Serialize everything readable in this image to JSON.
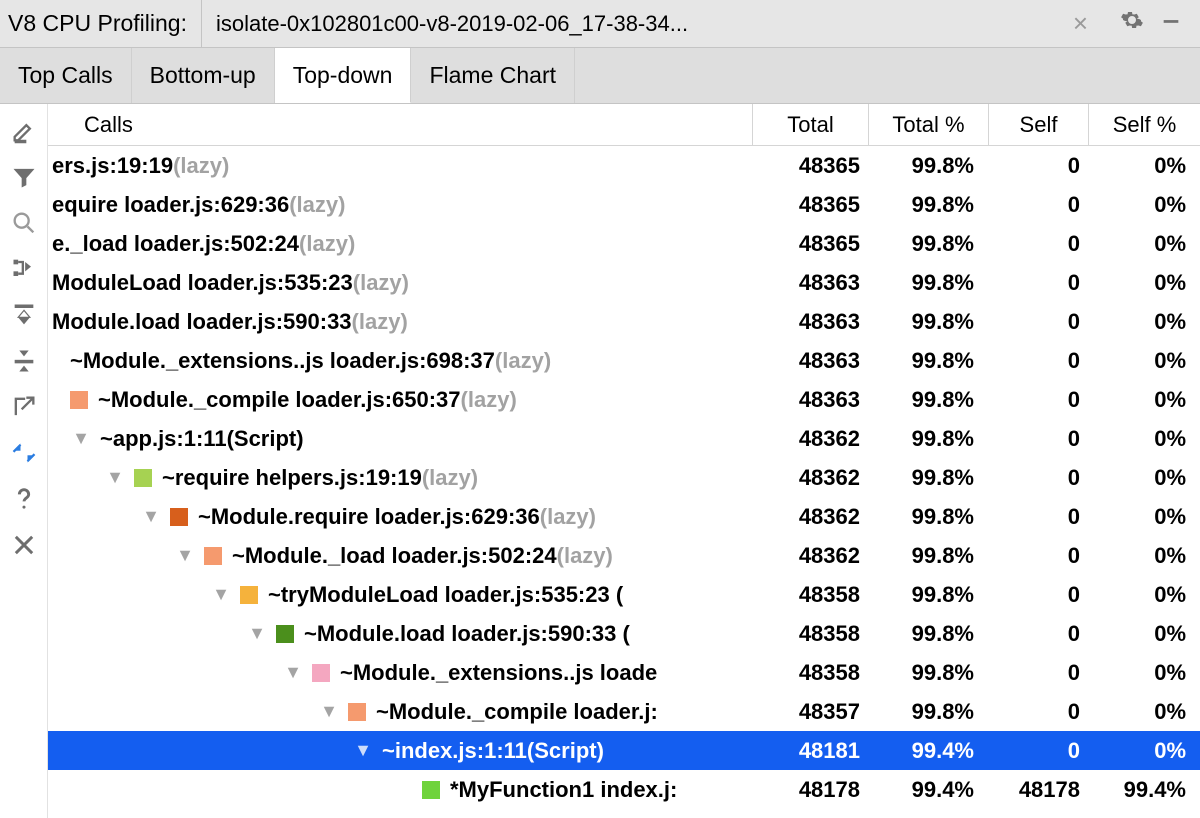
{
  "titlebar": {
    "title": "V8 CPU Profiling:",
    "file": "isolate-0x102801c00-v8-2019-02-06_17-38-34..."
  },
  "tabs": [
    "Top Calls",
    "Bottom-up",
    "Top-down",
    "Flame Chart"
  ],
  "active_tab": 2,
  "headers": {
    "calls": "Calls",
    "total": "Total",
    "total_pct": "Total %",
    "self": "Self",
    "self_pct": "Self %"
  },
  "rows": [
    {
      "indent": 0,
      "chev": false,
      "color": null,
      "label": "ers.js:19:19",
      "suffix": " (lazy)",
      "total": "48365",
      "total_pct": "99.8%",
      "self": "0",
      "self_pct": "0%",
      "sel": false
    },
    {
      "indent": 0,
      "chev": false,
      "color": null,
      "label": "equire loader.js:629:36",
      "suffix": " (lazy)",
      "total": "48365",
      "total_pct": "99.8%",
      "self": "0",
      "self_pct": "0%",
      "sel": false
    },
    {
      "indent": 0,
      "chev": false,
      "color": null,
      "label": "e._load loader.js:502:24",
      "suffix": " (lazy)",
      "total": "48365",
      "total_pct": "99.8%",
      "self": "0",
      "self_pct": "0%",
      "sel": false
    },
    {
      "indent": 0,
      "chev": false,
      "color": null,
      "label": "ModuleLoad loader.js:535:23",
      "suffix": " (lazy)",
      "total": "48363",
      "total_pct": "99.8%",
      "self": "0",
      "self_pct": "0%",
      "sel": false
    },
    {
      "indent": 0,
      "chev": false,
      "color": null,
      "label": "Module.load loader.js:590:33",
      "suffix": " (lazy)",
      "total": "48363",
      "total_pct": "99.8%",
      "self": "0",
      "self_pct": "0%",
      "sel": false
    },
    {
      "indent": 18,
      "chev": false,
      "color": null,
      "label": "~Module._extensions..js loader.js:698:37",
      "suffix": " (lazy)",
      "total": "48363",
      "total_pct": "99.8%",
      "self": "0",
      "self_pct": "0%",
      "sel": false
    },
    {
      "indent": 18,
      "chev": false,
      "color": "#f59a6e",
      "label": "~Module._compile loader.js:650:37",
      "suffix": " (lazy)",
      "total": "48363",
      "total_pct": "99.8%",
      "self": "0",
      "self_pct": "0%",
      "sel": false
    },
    {
      "indent": 18,
      "chev": true,
      "color": null,
      "label": "~app.js:1:11(Script)",
      "suffix": "",
      "total": "48362",
      "total_pct": "99.8%",
      "self": "0",
      "self_pct": "0%",
      "sel": false
    },
    {
      "indent": 52,
      "chev": true,
      "color": "#a6d252",
      "label": "~require helpers.js:19:19",
      "suffix": " (lazy)",
      "total": "48362",
      "total_pct": "99.8%",
      "self": "0",
      "self_pct": "0%",
      "sel": false
    },
    {
      "indent": 88,
      "chev": true,
      "color": "#d75f1c",
      "label": "~Module.require loader.js:629:36",
      "suffix": " (lazy)",
      "total": "48362",
      "total_pct": "99.8%",
      "self": "0",
      "self_pct": "0%",
      "sel": false
    },
    {
      "indent": 122,
      "chev": true,
      "color": "#f59a6e",
      "label": "~Module._load loader.js:502:24",
      "suffix": " (lazy)",
      "total": "48362",
      "total_pct": "99.8%",
      "self": "0",
      "self_pct": "0%",
      "sel": false
    },
    {
      "indent": 158,
      "chev": true,
      "color": "#f5b23c",
      "label": "~tryModuleLoad loader.js:535:23 (",
      "suffix": "",
      "total": "48358",
      "total_pct": "99.8%",
      "self": "0",
      "self_pct": "0%",
      "sel": false
    },
    {
      "indent": 194,
      "chev": true,
      "color": "#4b8f1c",
      "label": "~Module.load loader.js:590:33 (",
      "suffix": "",
      "total": "48358",
      "total_pct": "99.8%",
      "self": "0",
      "self_pct": "0%",
      "sel": false
    },
    {
      "indent": 230,
      "chev": true,
      "color": "#f4a7c0",
      "label": "~Module._extensions..js loade",
      "suffix": "",
      "total": "48358",
      "total_pct": "99.8%",
      "self": "0",
      "self_pct": "0%",
      "sel": false
    },
    {
      "indent": 266,
      "chev": true,
      "color": "#f59a6e",
      "label": "~Module._compile loader.j:",
      "suffix": "",
      "total": "48357",
      "total_pct": "99.8%",
      "self": "0",
      "self_pct": "0%",
      "sel": false
    },
    {
      "indent": 300,
      "chev": true,
      "color": null,
      "label": "~index.js:1:11(Script)",
      "suffix": "",
      "total": "48181",
      "total_pct": "99.4%",
      "self": "0",
      "self_pct": "0%",
      "sel": true
    },
    {
      "indent": 370,
      "chev": false,
      "color": "#6fd33b",
      "label": "*MyFunction1 index.j:",
      "suffix": "",
      "total": "48178",
      "total_pct": "99.4%",
      "self": "48178",
      "self_pct": "99.4%",
      "sel": false
    }
  ]
}
